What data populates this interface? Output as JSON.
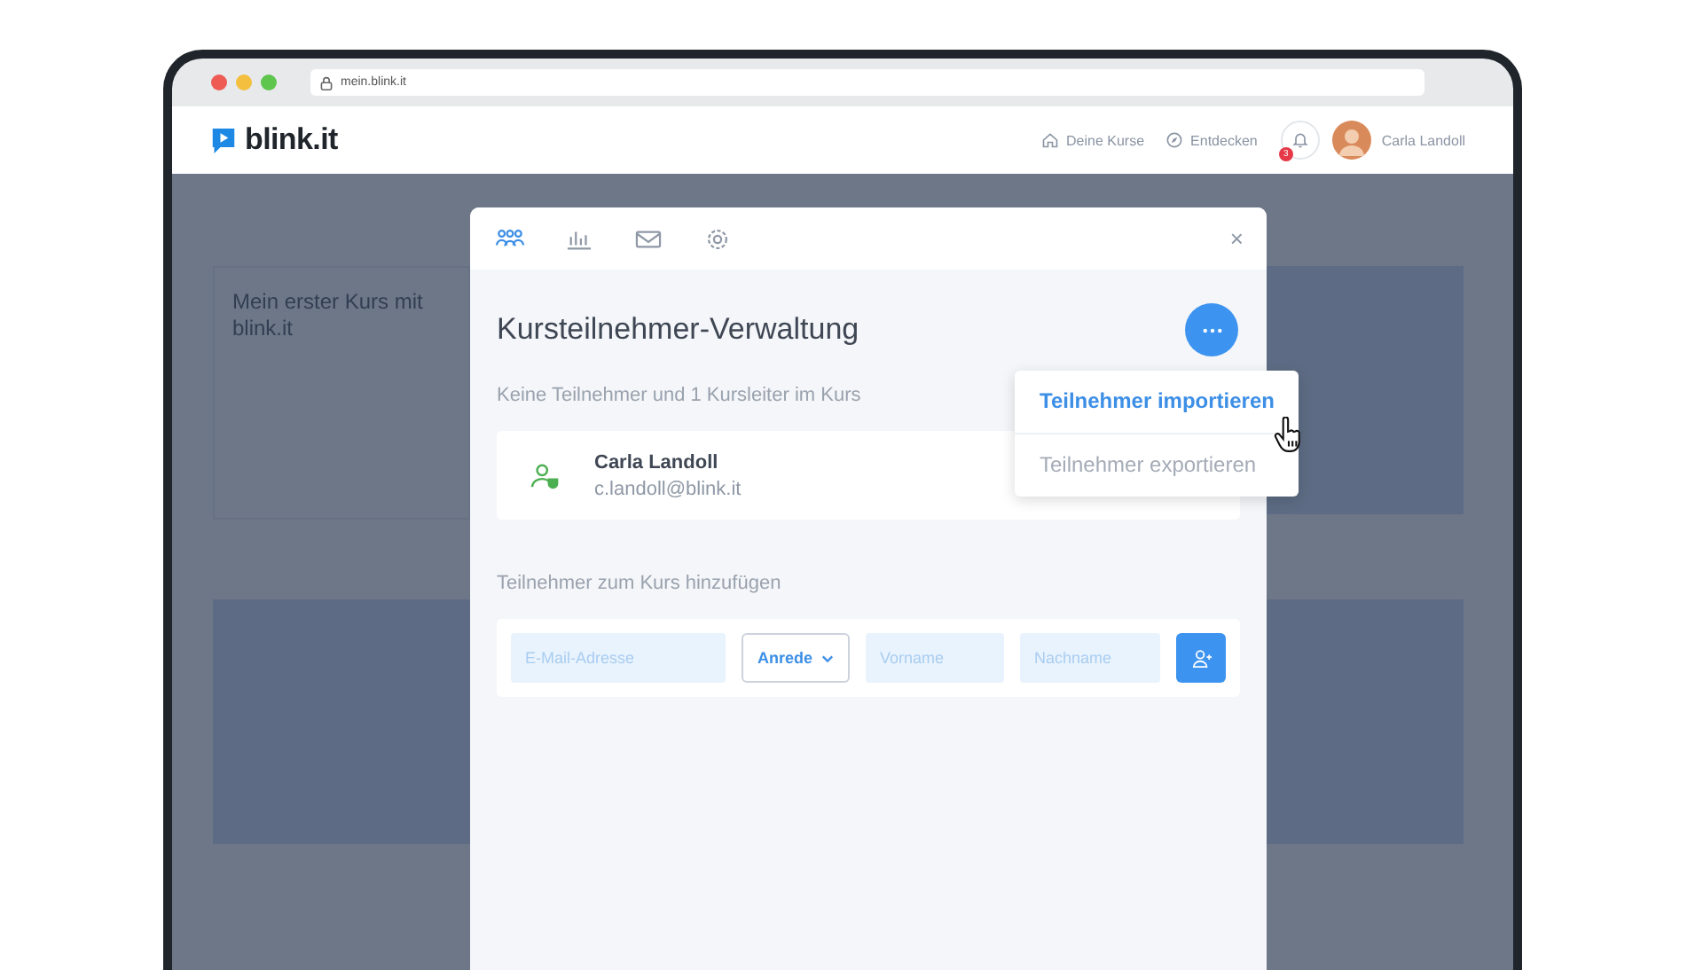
{
  "browser": {
    "url": "mein.blink.it"
  },
  "header": {
    "logo": "blink.it",
    "nav": [
      {
        "label": "Deine Kurse",
        "kind": "home"
      },
      {
        "label": "Entdecken",
        "kind": "compass"
      }
    ],
    "notifications": {
      "count": "3"
    },
    "user": {
      "name": "Carla Landoll"
    }
  },
  "background": {
    "course_title": "Mein erster Kurs mit blink.it"
  },
  "modal": {
    "tabs": [
      {
        "kind": "people",
        "selected": true
      },
      {
        "kind": "chart",
        "selected": false
      },
      {
        "kind": "mail",
        "selected": false
      },
      {
        "kind": "settings",
        "selected": false
      }
    ],
    "close": "×",
    "title": "Kursteilnehmer-Verwaltung",
    "summary": "Keine Teilnehmer und 1 Kursleiter im Kurs",
    "members": [
      {
        "name": "Carla Landoll",
        "email": "c.landoll@blink.it"
      }
    ],
    "menu": [
      {
        "label": "Teilnehmer importieren",
        "selected": true
      },
      {
        "label": "Teilnehmer exportieren",
        "selected": false
      }
    ],
    "add_label": "Teilnehmer zum Kurs hinzufügen",
    "form": {
      "email": {
        "placeholder": "E-Mail-Adresse"
      },
      "salutation": "Anrede",
      "first_name": {
        "placeholder": "Vorname"
      },
      "last_name": {
        "placeholder": "Nachname"
      }
    }
  }
}
